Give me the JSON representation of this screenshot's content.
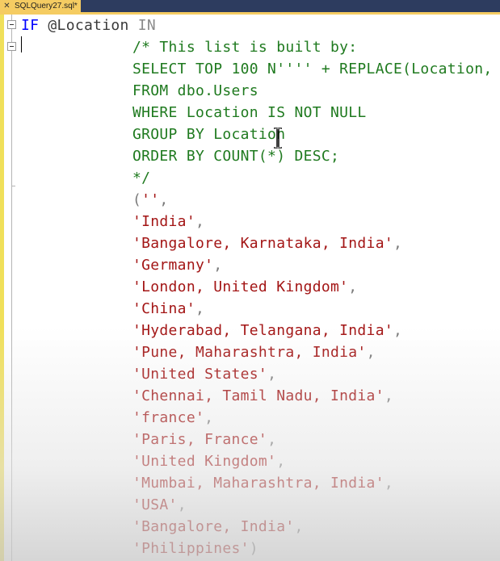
{
  "tab": {
    "close_glyph": "✕",
    "title": "SQLQuery27.sql*"
  },
  "colors": {
    "keyword": "#0000ff",
    "comment": "#1f7a1f",
    "string": "#a31515",
    "accent": "#f5cc62"
  },
  "code": {
    "l1_kw": "IF",
    "l1_var": " @Location",
    "l1_in": " IN",
    "l2": "/* This list is built by:",
    "l3": "SELECT TOP 100 N'''' + REPLACE(Location,",
    "l4": "FROM dbo.Users",
    "l5": "WHERE Location IS NOT NULL",
    "l6": "GROUP BY Location",
    "l7": "ORDER BY COUNT(*) DESC;",
    "l8": "*/",
    "l9_open": "(",
    "l9_str": "''",
    "l9_comma": ",",
    "items": [
      "'India'",
      "'Bangalore, Karnataka, India'",
      "'Germany'",
      "'London, United Kingdom'",
      "'China'",
      "'Hyderabad, Telangana, India'",
      "'Pune, Maharashtra, India'",
      "'United States'",
      "'Chennai, Tamil Nadu, India'",
      "'france'",
      "'Paris, France'",
      "'United Kingdom'",
      "'Mumbai, Maharashtra, India'",
      "'USA'",
      "'Bangalore, India'",
      "'Philippines'"
    ],
    "sep": ",",
    "close": ")"
  }
}
